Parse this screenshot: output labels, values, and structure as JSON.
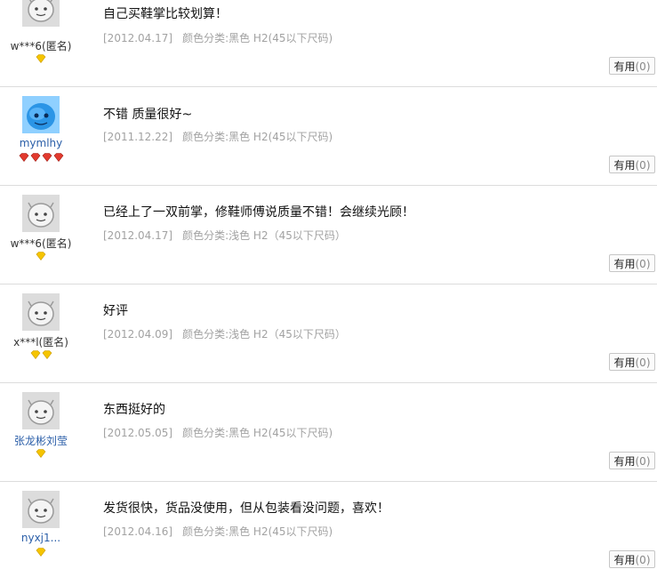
{
  "reviews": [
    {
      "user": "w***6(匿名)",
      "anonymous": true,
      "avatar": "default",
      "badge": "1 yellow diamond",
      "content": "自己买鞋掌比较划算！",
      "date": "[2012.04.17]",
      "sku": "颜色分类:黑色 H2(45以下尺码)",
      "useful_label": "有用",
      "useful_count": "(0)"
    },
    {
      "user": "mymlhy",
      "anonymous": false,
      "avatar": "blue-qq",
      "badge": "4 red diamonds",
      "content": "不错 质量很好~",
      "date": "[2011.12.22]",
      "sku": "颜色分类:黑色 H2(45以下尺码)",
      "useful_label": "有用",
      "useful_count": "(0)"
    },
    {
      "user": "w***6(匿名)",
      "anonymous": true,
      "avatar": "default",
      "badge": "1 yellow diamond",
      "content": "已经上了一双前掌，修鞋师傅说质量不错！会继续光顾！",
      "date": "[2012.04.17]",
      "sku": "颜色分类:浅色 H2（45以下尺码）",
      "useful_label": "有用",
      "useful_count": "(0)"
    },
    {
      "user": "x***l(匿名)",
      "anonymous": true,
      "avatar": "default",
      "badge": "2 yellow diamonds",
      "content": "好评",
      "date": "[2012.04.09]",
      "sku": "颜色分类:浅色 H2（45以下尺码）",
      "useful_label": "有用",
      "useful_count": "(0)"
    },
    {
      "user": "张龙彬刘莹",
      "anonymous": false,
      "avatar": "default",
      "badge": "1 yellow diamond",
      "content": "东西挺好的",
      "date": "[2012.05.05]",
      "sku": "颜色分类:黑色 H2(45以下尺码)",
      "useful_label": "有用",
      "useful_count": "(0)"
    },
    {
      "user": "nyxj1...",
      "anonymous": false,
      "avatar": "default",
      "badge": "1 yellow diamond",
      "content": "发货很快，货品没使用，但从包装看没问题，喜欢！",
      "date": "[2012.04.16]",
      "sku": "颜色分类:黑色 H2(45以下尺码)",
      "useful_label": "有用",
      "useful_count": "(0)"
    }
  ],
  "colors": {
    "link": "#2a5ea8",
    "meta": "#a2a2a2",
    "divider": "#dcdcdc",
    "gem_yellow": "#f5c400",
    "gem_red": "#e23a2e"
  },
  "icons": {
    "default_avatar": "smiley-face-icon",
    "qq_avatar": "qq-penguin-icon",
    "yellow_gem": "yellow-diamond-icon",
    "red_gem": "red-diamond-icon"
  }
}
